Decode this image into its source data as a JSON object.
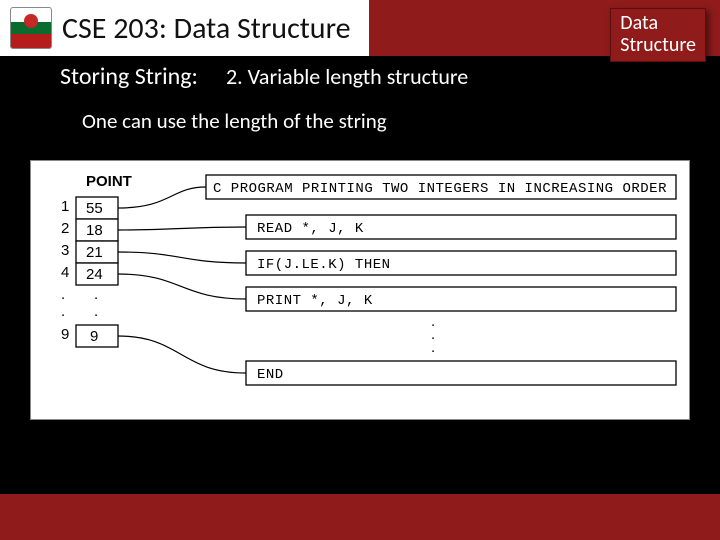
{
  "header": {
    "course_title": "CSE 203: Data Structure",
    "badge_line1": "Data",
    "badge_line2": "Structure"
  },
  "subhead": {
    "left": "Storing String:",
    "right": "2.   Variable length structure"
  },
  "body": "One can use the length of the string",
  "diagram": {
    "point_label": "POINT",
    "rows": [
      {
        "idx": "1",
        "val": "55"
      },
      {
        "idx": "2",
        "val": "18"
      },
      {
        "idx": "3",
        "val": "21"
      },
      {
        "idx": "4",
        "val": "24"
      },
      {
        "idx": ".",
        "val": "."
      },
      {
        "idx": ".",
        "val": "."
      },
      {
        "idx": "9",
        "val": "9"
      }
    ],
    "code_header": "C   PROGRAM PRINTING TWO INTEGERS IN INCREASING ORDER",
    "code_lines": [
      "READ *, J, K",
      "IF(J.LE.K) THEN",
      "PRINT *, J, K",
      "END"
    ]
  }
}
